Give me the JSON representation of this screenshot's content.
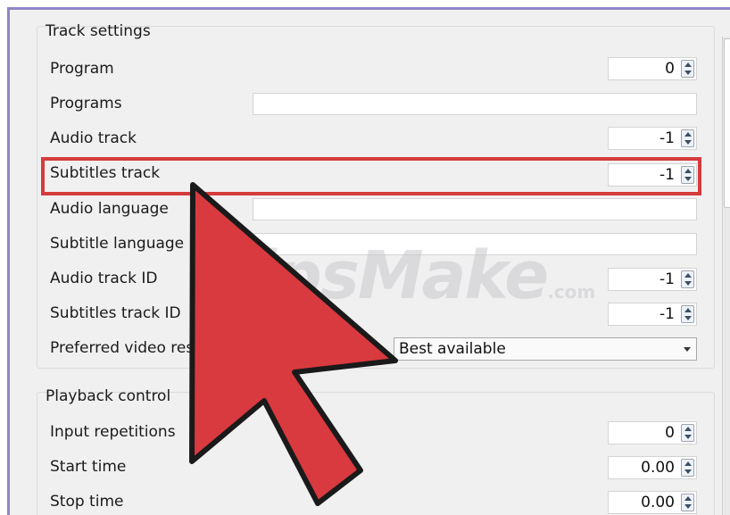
{
  "track_settings": {
    "title": "Track settings",
    "program_label": "Program",
    "program_value": "0",
    "programs_label": "Programs",
    "programs_value": "",
    "audio_track_label": "Audio track",
    "audio_track_value": "-1",
    "subtitles_track_label": "Subtitles track",
    "subtitles_track_value": "-1",
    "audio_language_label": "Audio language",
    "audio_language_value": "",
    "subtitle_language_label": "Subtitle language",
    "subtitle_language_value": "",
    "audio_track_id_label": "Audio track ID",
    "audio_track_id_value": "-1",
    "subtitles_track_id_label": "Subtitles track ID",
    "subtitles_track_id_value": "-1",
    "preferred_res_label": "Preferred video reso",
    "preferred_res_value": "Best available"
  },
  "playback_control": {
    "title": "Playback control",
    "input_repetitions_label": "Input repetitions",
    "input_repetitions_value": "0",
    "start_time_label": "Start time",
    "start_time_value": "0.00",
    "stop_time_label": "Stop time",
    "stop_time_value": "0.00"
  },
  "watermark": {
    "text": "TipsMake",
    "suffix": ".com"
  },
  "colors": {
    "highlight": "#d63b3b",
    "arrow_fill": "#d93a3f",
    "frame_border": "#8f86c6"
  },
  "icons": [
    "spin-arrows-icon",
    "dropdown-arrow-icon",
    "pointer-arrow-icon"
  ]
}
